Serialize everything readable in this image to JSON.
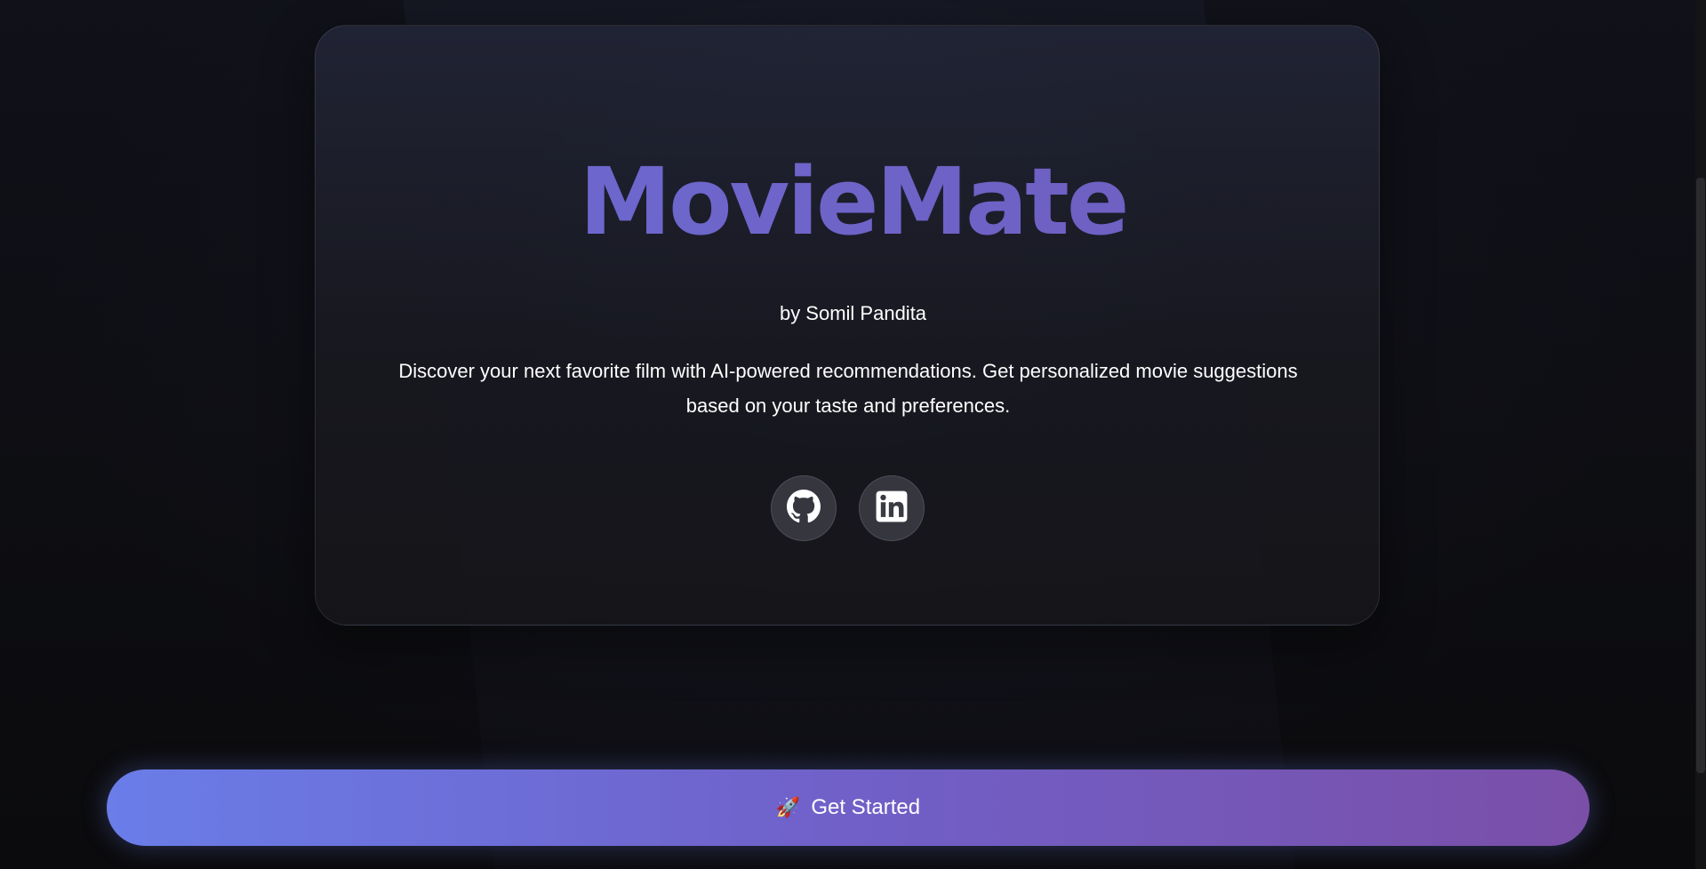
{
  "hero": {
    "title": "MovieMate",
    "byline": "by Somil Pandita",
    "description": "Discover your next favorite film with AI-powered recommendations. Get personalized movie suggestions based on your taste and preferences."
  },
  "social": {
    "github_icon": "github-icon",
    "linkedin_icon": "linkedin-icon"
  },
  "cta": {
    "icon": "rocket-icon",
    "label": "Get Started"
  },
  "colors": {
    "title_gradient_start": "#6a6fd8",
    "title_gradient_end": "#7258b8",
    "button_gradient_start": "#6a7de8",
    "button_gradient_end": "#7a4fa8",
    "background": "#0b0b0d"
  }
}
